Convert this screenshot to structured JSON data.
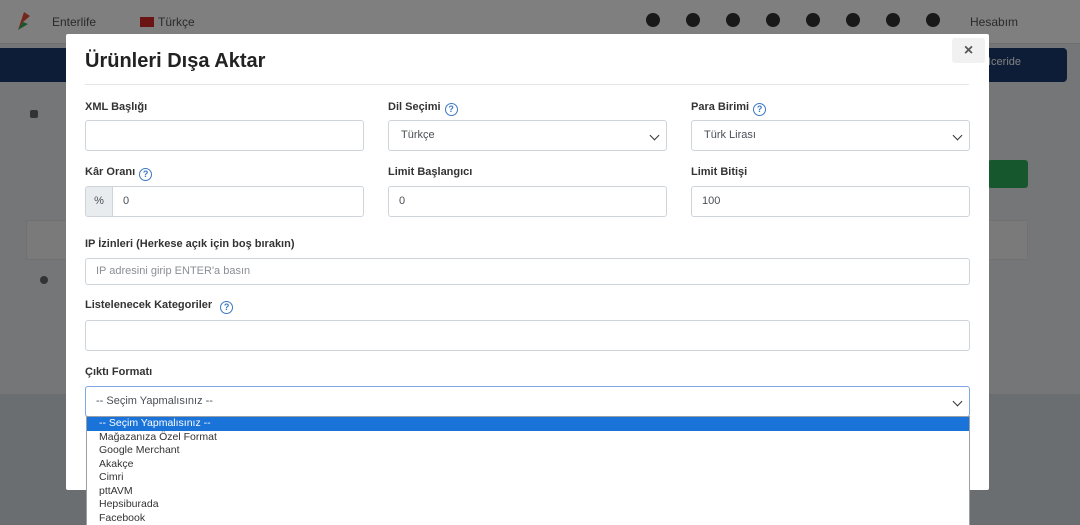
{
  "background": {
    "store_name": "Enterlife",
    "language": "Türkçe",
    "user_name": "Hesabım",
    "nav_button": "Iceride"
  },
  "modal": {
    "title": "Ürünleri Dışa Aktar",
    "close_label": "×"
  },
  "fields": {
    "xml_title": {
      "label": "XML Başlığı",
      "value": ""
    },
    "language": {
      "label": "Dil Seçimi",
      "value": "Türkçe"
    },
    "currency": {
      "label": "Para Birimi",
      "value": "Türk Lirası"
    },
    "profit_rate": {
      "label": "Kâr Oranı",
      "prefix": "%",
      "value": "0"
    },
    "limit_start": {
      "label": "Limit Başlangıcı",
      "value": "0"
    },
    "limit_end": {
      "label": "Limit Bitişi",
      "value": "100"
    },
    "ip_permissions": {
      "label": "IP İzinleri (Herkese açık için boş bırakın)",
      "placeholder": "IP adresini girip ENTER'a basın"
    },
    "categories": {
      "label": "Listelenecek Kategoriler",
      "value": ""
    },
    "output_format": {
      "label": "Çıktı Formatı",
      "value": "-- Seçim Yapmalısınız --"
    }
  },
  "help_icon_glyph": "?",
  "output_format_options": [
    "-- Seçim Yapmalısınız --",
    "Mağazanıza Özel Format",
    "Google Merchant",
    "Akakçe",
    "Cimri",
    "pttAVM",
    "Hepsiburada",
    "Facebook"
  ],
  "colors": {
    "accent": "#1a73d9",
    "nav": "#1c3b6e",
    "success": "#2fae5b"
  }
}
